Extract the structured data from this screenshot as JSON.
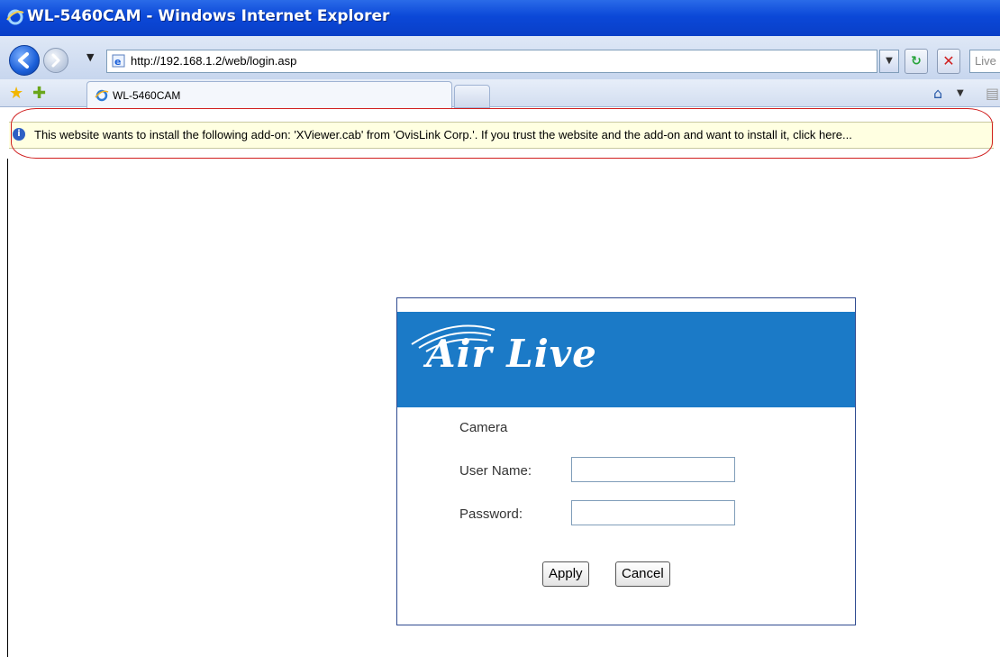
{
  "window": {
    "title": "WL-5460CAM - Windows Internet Explorer"
  },
  "address": {
    "url": "http://192.168.1.2/web/login.asp",
    "search_placeholder": "Live"
  },
  "tabs": [
    {
      "label": "WL-5460CAM"
    }
  ],
  "infobar": {
    "message": "This website wants to install the following add-on: 'XViewer.cab' from 'OvisLink Corp.'. If you trust the website and the add-on and want to install it, click here..."
  },
  "login": {
    "logo": "Air Live",
    "heading": "Camera",
    "username_label": "User Name:",
    "password_label": "Password:",
    "username_value": "",
    "password_value": "",
    "apply_label": "Apply",
    "cancel_label": "Cancel"
  },
  "colors": {
    "banner": "#1b7ac7",
    "titlebar": "#0b48d8",
    "infobar_bg": "#ffffe1",
    "highlight": "#d01e1e"
  }
}
